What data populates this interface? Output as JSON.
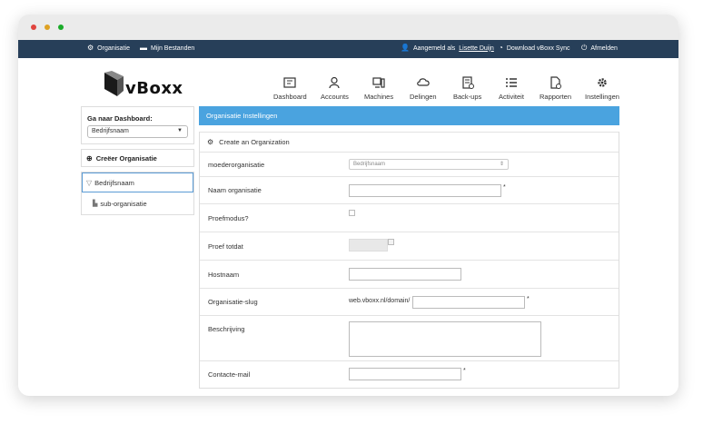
{
  "window": {
    "dots": [
      "#e0443e",
      "#dea123",
      "#1aab29"
    ]
  },
  "topnav": {
    "organisatie": "Organisatie",
    "mijn_bestanden": "Mijn Bestanden",
    "aangemeld_prefix": "Aangemeld als",
    "user": "Lisette Duijn",
    "download": "Download vBoxx Sync",
    "afmelden": "Afmelden"
  },
  "logo": {
    "text": "vBoxx"
  },
  "mainnav": [
    {
      "label": "Dashboard",
      "icon": "dashboard-icon"
    },
    {
      "label": "Accounts",
      "icon": "user-icon"
    },
    {
      "label": "Machines",
      "icon": "machines-icon"
    },
    {
      "label": "Delingen",
      "icon": "cloud-share-icon"
    },
    {
      "label": "Back-ups",
      "icon": "backup-icon"
    },
    {
      "label": "Activiteit",
      "icon": "list-icon"
    },
    {
      "label": "Rapporten",
      "icon": "report-icon"
    },
    {
      "label": "Instellingen",
      "icon": "gear-icon"
    }
  ],
  "sidebar": {
    "dashboard_label": "Ga naar Dashboard:",
    "dashboard_value": "Bedrijfsnaam",
    "create_org": "Creëer Organisatie",
    "tree_top": "Bedrijfsnaam",
    "tree_sub": "sub-organisatie"
  },
  "panel": {
    "title": "Organisatie Instellingen",
    "create_label": "Create an Organization",
    "fields": {
      "moederorganisatie": {
        "label": "moederorganisatie",
        "value": "Bedrijfsnaam"
      },
      "naam": {
        "label": "Naam organisatie",
        "required": "*"
      },
      "proefmodus": {
        "label": "Proefmodus?"
      },
      "proef_totdat": {
        "label": "Proef totdat"
      },
      "hostnaam": {
        "label": "Hostnaam"
      },
      "slug": {
        "label": "Organisatie-slug",
        "prefix": "web.vboxx.nl/domain/",
        "required": "*"
      },
      "beschrijving": {
        "label": "Beschrijving"
      },
      "contact": {
        "label": "Contacte-mail",
        "required": "*"
      }
    }
  }
}
